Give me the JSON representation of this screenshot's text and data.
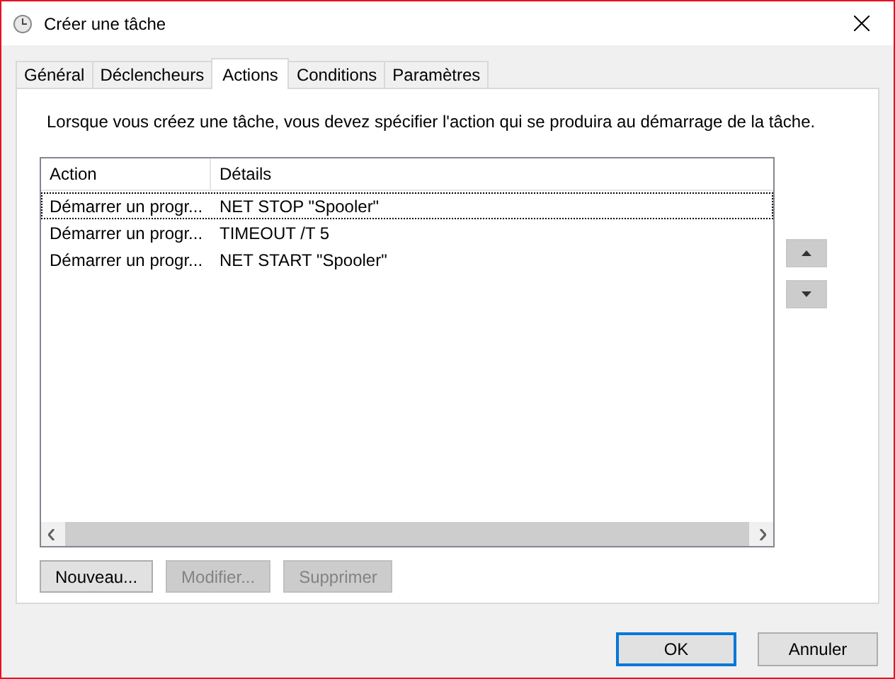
{
  "window": {
    "title": "Créer une tâche"
  },
  "tabs": [
    {
      "label": "Général",
      "selected": false
    },
    {
      "label": "Déclencheurs",
      "selected": false
    },
    {
      "label": "Actions",
      "selected": true
    },
    {
      "label": "Conditions",
      "selected": false
    },
    {
      "label": "Paramètres",
      "selected": false
    }
  ],
  "description": "Lorsque vous créez une tâche, vous devez spécifier l'action qui se produira au démarrage de la tâche.",
  "actions_table": {
    "columns": [
      "Action",
      "Détails"
    ],
    "rows": [
      {
        "action": "Démarrer un progr...",
        "details": "NET STOP \"Spooler\"",
        "focused": true
      },
      {
        "action": "Démarrer un progr...",
        "details": "TIMEOUT /T 5",
        "focused": false
      },
      {
        "action": "Démarrer un progr...",
        "details": "NET START \"Spooler\"",
        "focused": false
      }
    ]
  },
  "buttons": [
    {
      "label": "Nouveau...",
      "disabled": false
    },
    {
      "label": "Modifier...",
      "disabled": true
    },
    {
      "label": "Supprimer",
      "disabled": true
    }
  ],
  "dialog_buttons": [
    {
      "label": "OK",
      "default": true
    },
    {
      "label": "Annuler",
      "default": false
    }
  ]
}
